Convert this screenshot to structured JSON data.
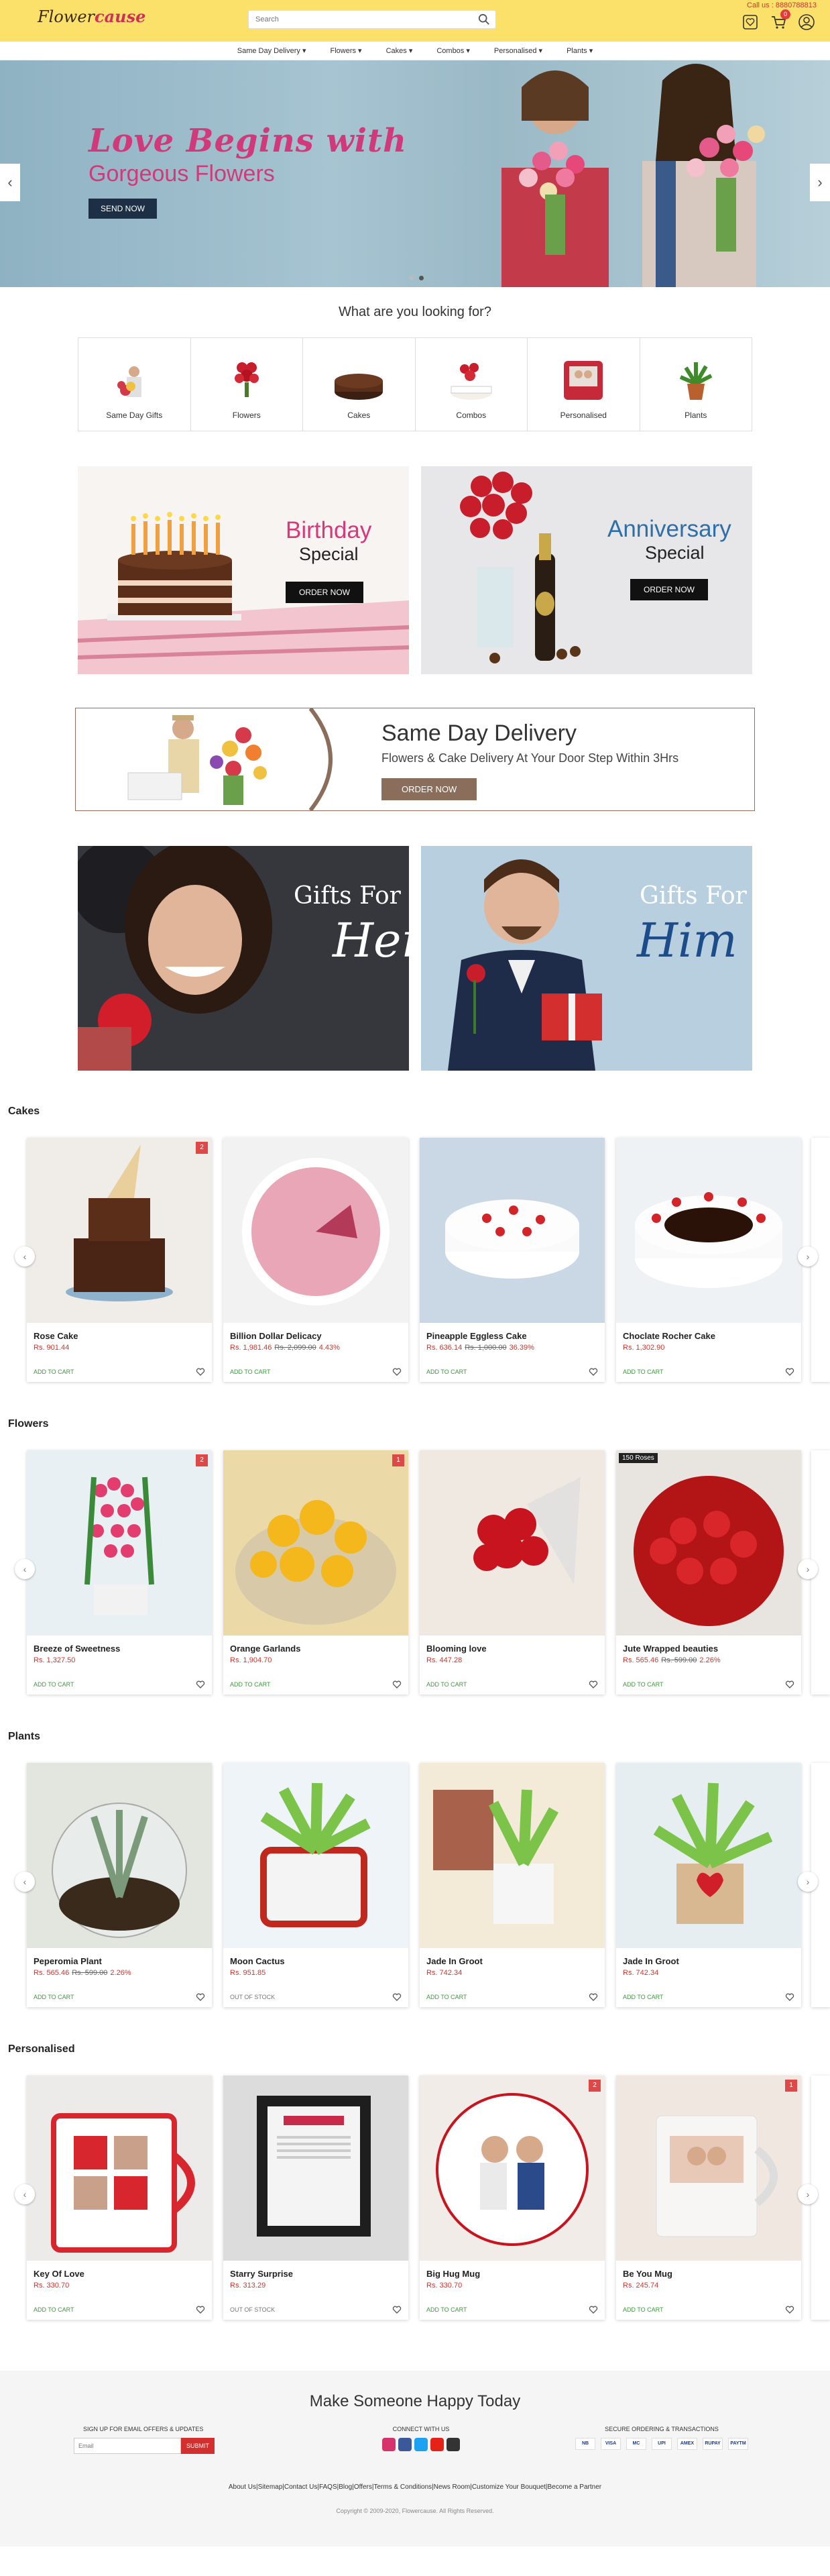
{
  "header": {
    "logo_a": "Flower",
    "logo_b": "cause",
    "call_us": "Call us : 8880788813",
    "search_placeholder": "Search",
    "cart_count": "0"
  },
  "nav": [
    "Same Day Delivery ▾",
    "Flowers ▾",
    "Cakes ▾",
    "Combos ▾",
    "Personalised ▾",
    "Plants ▾"
  ],
  "hero": {
    "line1": "Love Begins with",
    "line2": "Gorgeous Flowers",
    "button": "SEND NOW",
    "prev": "‹",
    "next": "›"
  },
  "looking": {
    "title": "What are you looking for?",
    "items": [
      "Same Day Gifts",
      "Flowers",
      "Cakes",
      "Combos",
      "Personalised",
      "Plants"
    ]
  },
  "promos": {
    "birthday": {
      "t1": "Birthday",
      "t2": "Special",
      "btn": "ORDER NOW"
    },
    "anniversary": {
      "t1": "Anniversary",
      "t2": "Special",
      "btn": "ORDER NOW"
    }
  },
  "same_day": {
    "title": "Same Day Delivery",
    "subtitle": "Flowers & Cake Delivery At Your Door Step Within 3Hrs",
    "btn": "ORDER NOW"
  },
  "gifts": {
    "her_a": "Gifts For",
    "her_b": "Her",
    "him_a": "Gifts For",
    "him_b": "Him"
  },
  "sections": [
    {
      "title": "Cakes",
      "products": [
        {
          "name": "Rose Cake",
          "price": "Rs. 901.44",
          "old": "",
          "discount": "",
          "action": "ADD TO CART",
          "tag": "2"
        },
        {
          "name": "Billion Dollar Delicacy",
          "price": "Rs. 1,981.46",
          "old": "Rs. 2,099.00",
          "discount": "4.43%",
          "action": "ADD TO CART",
          "tag": ""
        },
        {
          "name": "Pineapple Eggless Cake",
          "price": "Rs. 636.14",
          "old": "Rs. 1,000.00",
          "discount": "36.39%",
          "action": "ADD TO CART",
          "tag": ""
        },
        {
          "name": "Choclate Rocher Cake",
          "price": "Rs. 1,302.90",
          "old": "",
          "discount": "",
          "action": "ADD TO CART",
          "tag": ""
        }
      ]
    },
    {
      "title": "Flowers",
      "products": [
        {
          "name": "Breeze of Sweetness",
          "price": "Rs. 1,327.50",
          "old": "",
          "discount": "",
          "action": "ADD TO CART",
          "tag": "2"
        },
        {
          "name": "Orange Garlands",
          "price": "Rs. 1,904.70",
          "old": "",
          "discount": "",
          "action": "ADD TO CART",
          "tag": "1"
        },
        {
          "name": "Blooming love",
          "price": "Rs. 447.28",
          "old": "",
          "discount": "",
          "action": "ADD TO CART",
          "tag": ""
        },
        {
          "name": "Jute Wrapped beauties",
          "price": "Rs. 565.46",
          "old": "Rs. 599.00",
          "discount": "2.26%",
          "action": "ADD TO CART",
          "tag": "",
          "label": "150 Roses"
        }
      ]
    },
    {
      "title": "Plants",
      "products": [
        {
          "name": "Peperomia Plant",
          "price": "Rs. 565.46",
          "old": "Rs. 599.00",
          "discount": "2.26%",
          "action": "ADD TO CART",
          "tag": ""
        },
        {
          "name": "Moon Cactus",
          "price": "Rs. 951.85",
          "old": "",
          "discount": "",
          "action": "OUT OF STOCK",
          "tag": ""
        },
        {
          "name": "Jade In Groot",
          "price": "Rs. 742.34",
          "old": "",
          "discount": "",
          "action": "ADD TO CART",
          "tag": ""
        },
        {
          "name": "Jade In Groot",
          "price": "Rs. 742.34",
          "old": "",
          "discount": "",
          "action": "ADD TO CART",
          "tag": ""
        }
      ]
    },
    {
      "title": "Personalised",
      "products": [
        {
          "name": "Key Of Love",
          "price": "Rs. 330.70",
          "old": "",
          "discount": "",
          "action": "ADD TO CART",
          "tag": ""
        },
        {
          "name": "Starry Surprise",
          "price": "Rs. 313.29",
          "old": "",
          "discount": "",
          "action": "OUT OF STOCK",
          "tag": ""
        },
        {
          "name": "Big Hug Mug",
          "price": "Rs. 330.70",
          "old": "",
          "discount": "",
          "action": "ADD TO CART",
          "tag": "2"
        },
        {
          "name": "Be You Mug",
          "price": "Rs. 245.74",
          "old": "",
          "discount": "",
          "action": "ADD TO CART",
          "tag": "1"
        }
      ]
    }
  ],
  "footer": {
    "title": "Make Someone Happy Today",
    "signup_label": "SIGN UP FOR EMAIL OFFERS & UPDATES",
    "email_placeholder": "Email",
    "submit": "SUBMIT",
    "connect_label": "CONNECT WITH US",
    "secure_label": "SECURE ORDERING & TRANSACTIONS",
    "pay": [
      "NB",
      "VISA",
      "MC",
      "UPI",
      "AMEX",
      "RUPAY",
      "PAYTM"
    ],
    "links": "About Us|Sitemap|Contact Us|FAQS|Blog|Offers|Terms & Conditions|News Room|Customize Your Bouquet|Become a Partner",
    "copyright": "Copyright © 2009-2020, Flowercause. All Rights Reserved."
  }
}
